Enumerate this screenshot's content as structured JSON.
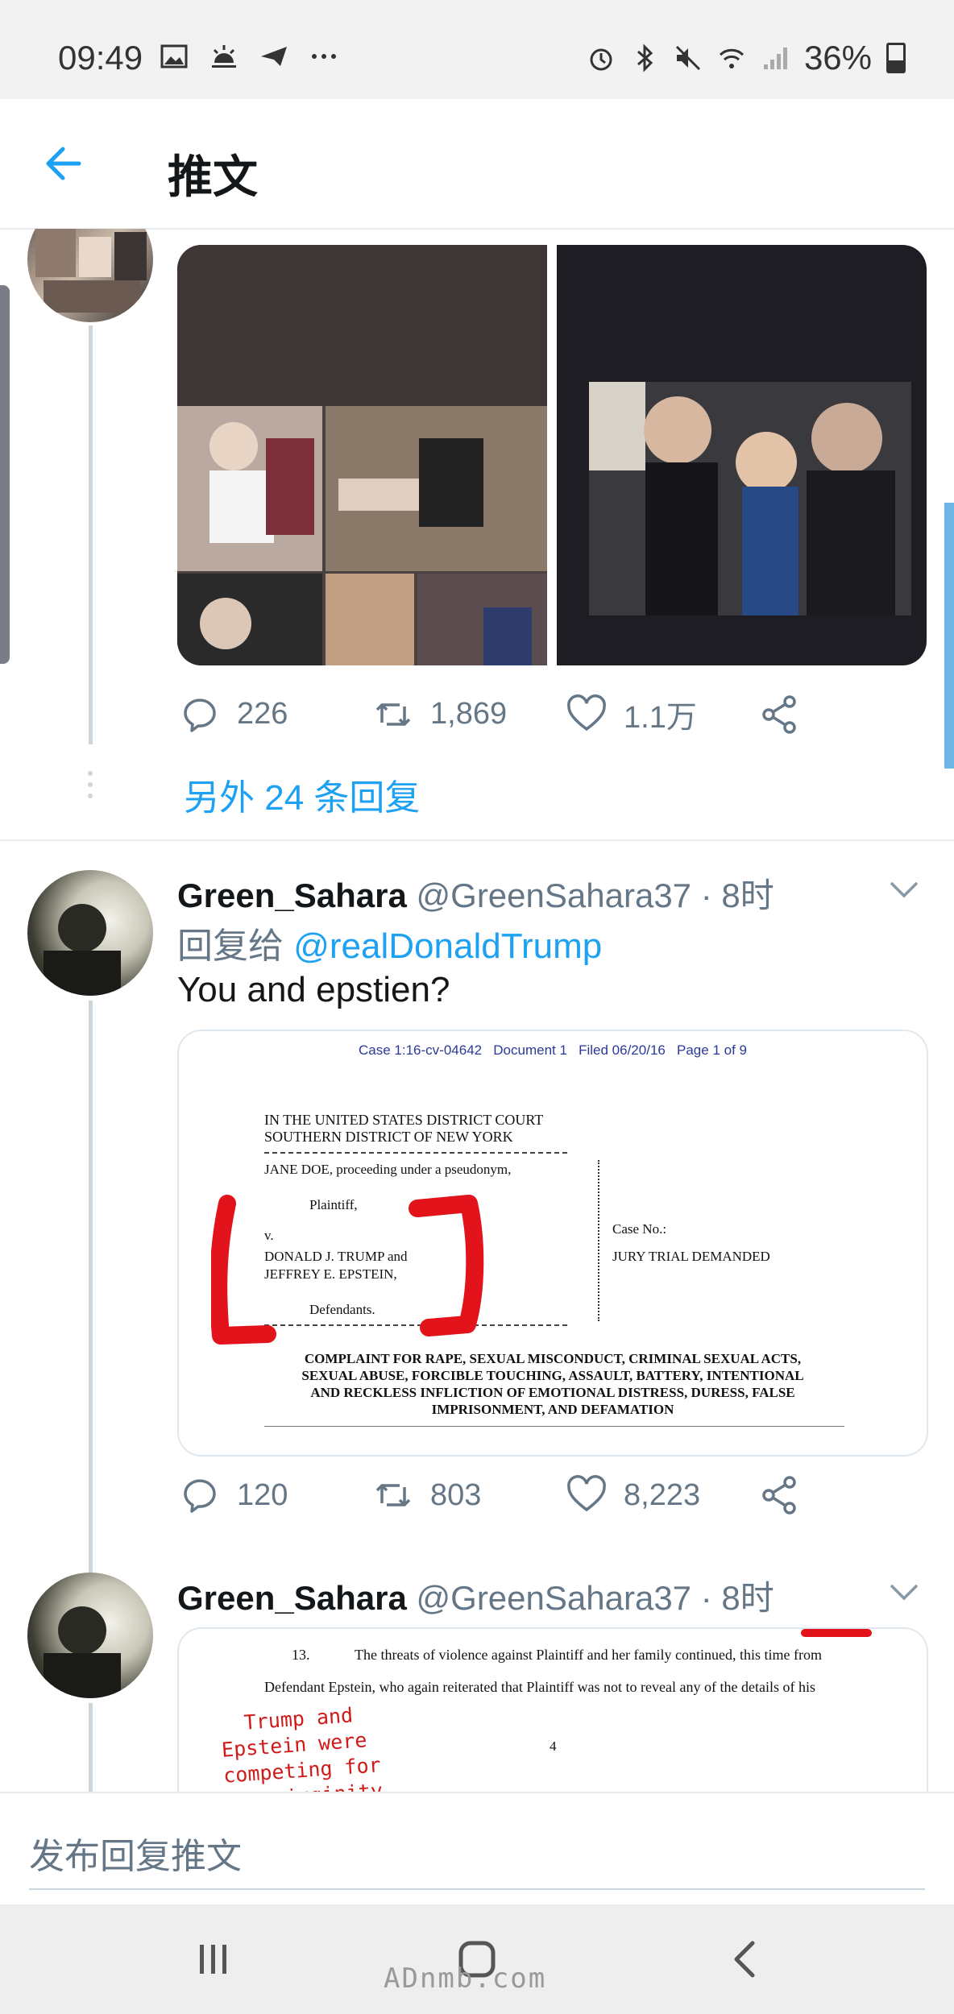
{
  "status_bar": {
    "time": "09:49",
    "left_icons": [
      "image-icon",
      "weather-icon",
      "send-icon",
      "more-dots-icon"
    ],
    "right_icons": [
      "alarm-icon",
      "bluetooth-icon",
      "mute-icon",
      "wifi-icon",
      "signal-icon"
    ],
    "battery": "36%"
  },
  "header": {
    "title": "推文"
  },
  "tweet1": {
    "replies": "226",
    "retweets": "1,869",
    "likes": "1.1万",
    "more_replies": "另外 24 条回复"
  },
  "tweet2": {
    "name": "Green_Sahara",
    "handle": "@GreenSahara37 · 8时",
    "reply_prefix": "回复给",
    "reply_mention": "@realDonaldTrump",
    "text": "You and epstien?",
    "document": {
      "header": "Case 1:16-cv-04642   Document 1   Filed 06/20/16   Page 1 of 9",
      "court_1": "IN THE UNITED STATES DISTRICT COURT",
      "court_2": "SOUTHERN DISTRICT OF NEW YORK",
      "plaintiff_line": "JANE DOE, proceeding under a pseudonym,",
      "plaintiff": "Plaintiff,",
      "v": "v.",
      "defendant_1": "DONALD J. TRUMP and",
      "defendant_2": "JEFFREY E. EPSTEIN,",
      "defendants": "Defendants.",
      "case_no": "Case No.:",
      "jury": "JURY TRIAL DEMANDED",
      "complaint_1": "COMPLAINT FOR RAPE, SEXUAL MISCONDUCT, CRIMINAL SEXUAL ACTS,",
      "complaint_2": "SEXUAL ABUSE, FORCIBLE TOUCHING, ASSAULT, BATTERY, INTENTIONAL",
      "complaint_3": "AND RECKLESS INFLICTION OF EMOTIONAL DISTRESS, DURESS, FALSE",
      "complaint_4": "IMPRISONMENT, AND DEFAMATION"
    },
    "replies": "120",
    "retweets": "803",
    "likes": "8,223"
  },
  "tweet3": {
    "name": "Green_Sahara",
    "handle": "@GreenSahara37 · 8时",
    "document": {
      "para_num": "13.",
      "line_1": "The threats of violence against Plaintiff and her family continued, this time from",
      "line_2": "Defendant Epstein, who again reiterated that Plaintiff was not to reveal any of the details of his",
      "annotation_1": "Trump and",
      "annotation_2": "Epstein were",
      "annotation_3": "competing for",
      "annotation_4": "the virginity",
      "page_num": "4"
    }
  },
  "reply_bar": {
    "placeholder": "发布回复推文"
  },
  "watermark": "ADnmb.com",
  "colors": {
    "accent": "#1da1f2",
    "secondary_text": "#657786",
    "annotation_red": "#e3131b"
  }
}
